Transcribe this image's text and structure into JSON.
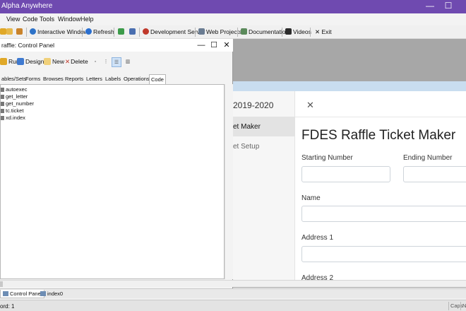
{
  "app": {
    "title": "Alpha Anywhere",
    "minimize_glyph": "—",
    "maximize_glyph": "☐"
  },
  "menu": [
    "View",
    "Code",
    "Tools",
    "Window",
    "Help"
  ],
  "toolbar": {
    "interactive_window": "Interactive Window",
    "refresh": "Refresh",
    "development_server": "Development Server",
    "web_projects": "Web Projects",
    "documentation": "Documentation",
    "videos": "Videos",
    "exit": "Exit",
    "exit_glyph": "✕"
  },
  "control_panel": {
    "title": "raffle: Control Panel",
    "minimize_glyph": "—",
    "restore_glyph": "☐",
    "close_glyph": "✕",
    "tools": {
      "run": "Run",
      "design": "Design",
      "new": "New",
      "delete": "Delete",
      "delete_glyph": "✕"
    },
    "tabs": [
      "ables/Sets",
      "Forms",
      "Browses",
      "Reports",
      "Letters",
      "Labels",
      "Operations",
      "Code"
    ],
    "active_tab": "Code",
    "items": [
      "autoexec",
      "get_letter",
      "get_number",
      "tc.ticket",
      "xd.index"
    ]
  },
  "web": {
    "year": "2019-2020",
    "close_glyph": "✕",
    "nav": [
      "et Maker",
      "et Setup"
    ],
    "heading": "FDES Raffle Ticket Maker",
    "labels": {
      "starting_number": "Starting Number",
      "ending_number": "Ending Number",
      "name": "Name",
      "address1": "Address 1",
      "address2": "Address 2"
    }
  },
  "doc_tabs": [
    "Control Panel",
    "index0"
  ],
  "status": {
    "record": "ord: 1",
    "caps": "Caps",
    "num": "Nu"
  },
  "colors": {
    "titlebar": "#6f4ab0",
    "panel_bg": "#f3f3f3",
    "workspace": "#a7a7a7"
  }
}
